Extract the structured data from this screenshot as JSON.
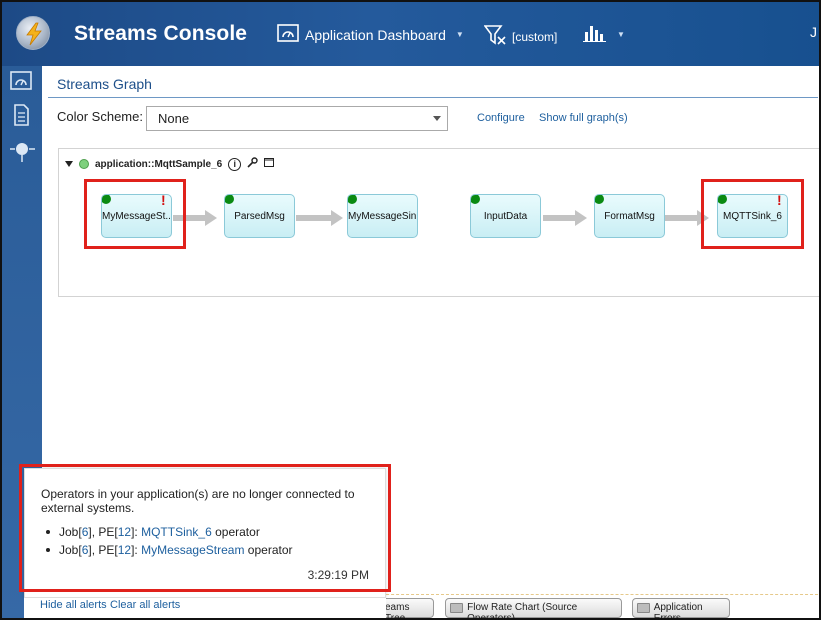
{
  "header": {
    "title": "Streams Console",
    "dashboard_label": "Application Dashboard",
    "filter_label": "[custom]",
    "right_label": "J"
  },
  "sidebar": {
    "items": [
      {
        "icon": "dashboard-icon"
      },
      {
        "icon": "document-icon"
      },
      {
        "icon": "network-icon"
      }
    ]
  },
  "panel": {
    "title": "Streams Graph"
  },
  "color_scheme": {
    "label": "Color Scheme:",
    "value": "None"
  },
  "links": {
    "configure": "Configure",
    "show_full": "Show full graph(s)"
  },
  "graph": {
    "application_name": "application::MqttSample_6",
    "nodes": [
      {
        "label": "MyMessageSt...",
        "alert": "!"
      },
      {
        "label": "ParsedMsg"
      },
      {
        "label": "MyMessageSink"
      },
      {
        "label": "InputData"
      },
      {
        "label": "FormatMsg"
      },
      {
        "label": "MQTTSink_6",
        "alert": "!"
      }
    ]
  },
  "alert": {
    "message": "Operators in your application(s) are no longer connected to external systems.",
    "items": [
      {
        "prefix": "Job[",
        "job": "6",
        "mid": "], PE[",
        "pe": "12",
        "post": "]: ",
        "operator": "MQTTSink_6",
        "suffix": " operator"
      },
      {
        "prefix": "Job[",
        "job": "6",
        "mid": "], PE[",
        "pe": "12",
        "post": "]: ",
        "operator": "MyMessageStream",
        "suffix": " operator"
      }
    ],
    "time": "3:29:19 PM",
    "hide_all": "Hide all alerts",
    "clear_all": "Clear all alerts"
  },
  "bottom_tabs": {
    "streams_tree": "eams Tree",
    "flow_rate": "Flow Rate Chart (Source Operators)",
    "app_errors": "Application Errors"
  },
  "colors": {
    "header": "#245a9c",
    "highlight": "#e0211b",
    "status_ok": "#0a8a12",
    "link": "#1d5f9e"
  }
}
